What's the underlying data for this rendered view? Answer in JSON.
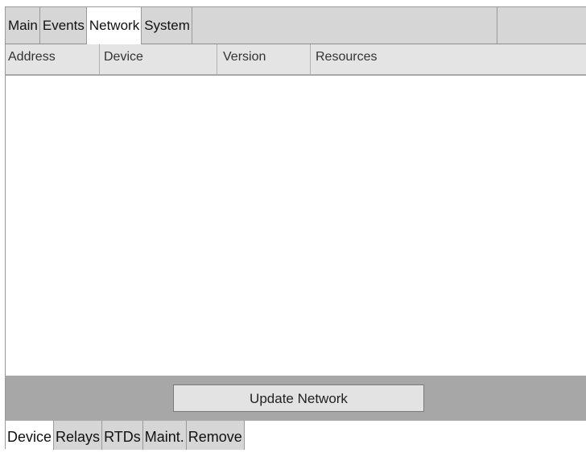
{
  "top_tabs": [
    {
      "label": "Main"
    },
    {
      "label": "Events"
    },
    {
      "label": "Network"
    },
    {
      "label": "System"
    }
  ],
  "active_top_tab": "Network",
  "columns": [
    {
      "label": "Address"
    },
    {
      "label": "Device"
    },
    {
      "label": "Version"
    },
    {
      "label": "Resources"
    }
  ],
  "rows": [],
  "action": {
    "update_label": "Update Network"
  },
  "bottom_tabs": [
    {
      "label": "Device"
    },
    {
      "label": "Relays"
    },
    {
      "label": "RTDs"
    },
    {
      "label": "Maint."
    },
    {
      "label": "Remove"
    }
  ],
  "active_bottom_tab": "Device",
  "colors": {
    "tab_bg": "#d6d6d6",
    "active_tab_bg": "#ffffff",
    "header_bg": "#e4e4e4",
    "action_bar_bg": "#a7a7a7",
    "button_bg": "#e3e3e3"
  }
}
